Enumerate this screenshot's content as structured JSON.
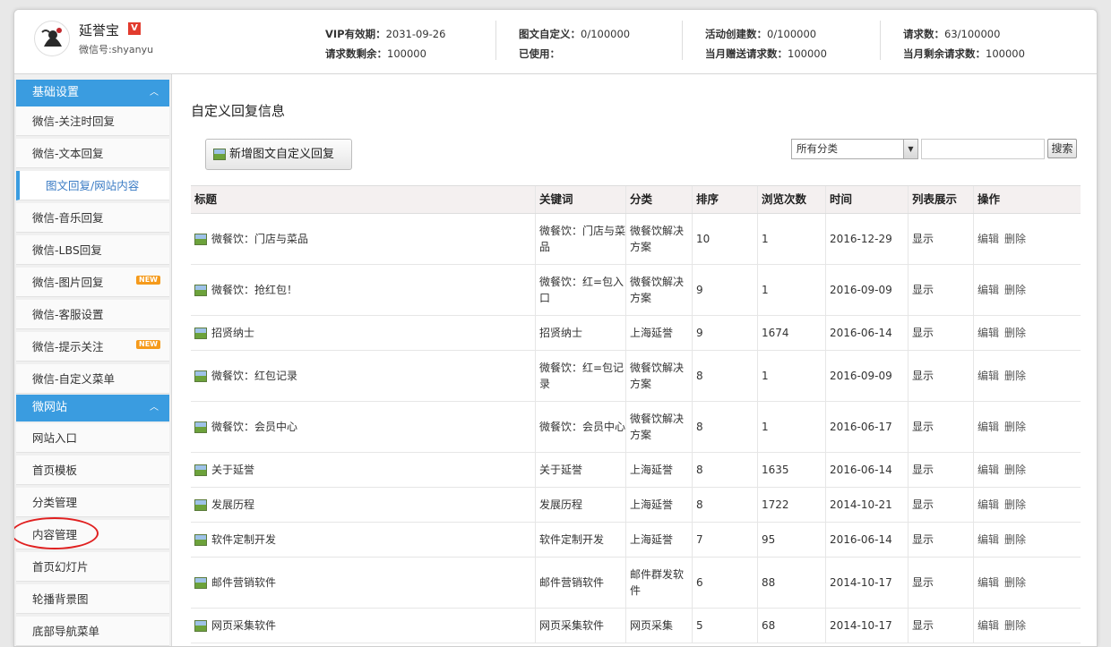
{
  "header": {
    "brand_name": "延誉宝",
    "brand_badge": "V",
    "wechat_id": "微信号:shyanyu",
    "stats": [
      {
        "k1": "VIP有效期：",
        "v1": "2031-09-26",
        "k2": "请求数剩余：",
        "v2": "100000"
      },
      {
        "k1": "图文自定义：",
        "v1": "0/100000",
        "k2": "已使用：",
        "v2": ""
      },
      {
        "k1": "活动创建数：",
        "v1": "0/100000",
        "k2": "当月赠送请求数：",
        "v2": "100000"
      },
      {
        "k1": "请求数：",
        "v1": "63/100000",
        "k2": "当月剩余请求数：",
        "v2": "100000"
      }
    ]
  },
  "sidebar": {
    "sections": [
      {
        "title": "基础设置",
        "chevron": "︿"
      },
      {
        "title": "微网站",
        "chevron": "︿"
      }
    ],
    "items": [
      {
        "label": "微信-关注时回复"
      },
      {
        "label": "微信-文本回复"
      },
      {
        "label": "图文回复/网站内容"
      },
      {
        "label": "微信-音乐回复"
      },
      {
        "label": "微信-LBS回复"
      },
      {
        "label": "微信-图片回复",
        "badge": "NEW"
      },
      {
        "label": "微信-客服设置"
      },
      {
        "label": "微信-提示关注",
        "badge": "NEW"
      },
      {
        "label": "微信-自定义菜单"
      },
      {
        "label": "网站入口"
      },
      {
        "label": "首页模板"
      },
      {
        "label": "分类管理"
      },
      {
        "label": "内容管理"
      },
      {
        "label": "首页幻灯片"
      },
      {
        "label": "轮播背景图"
      },
      {
        "label": "底部导航菜单"
      }
    ]
  },
  "main": {
    "title": "自定义回复信息",
    "add_button": "新增图文自定义回复",
    "category_select": "所有分类",
    "search_value": "",
    "search_button": "搜索",
    "columns": [
      "标题",
      "关键词",
      "分类",
      "排序",
      "浏览次数",
      "时间",
      "列表展示",
      "操作"
    ],
    "op_edit": "编辑",
    "op_delete": "删除",
    "rows": [
      {
        "title": "微餐饮：门店与菜品",
        "keyword": "微餐饮：门店与菜品",
        "category": "微餐饮解决方案",
        "order": "10",
        "views": "1",
        "date": "2016-12-29",
        "display": "显示"
      },
      {
        "title": "微餐饮：抢红包！",
        "keyword": "微餐饮：红=包入口",
        "category": "微餐饮解决方案",
        "order": "9",
        "views": "1",
        "date": "2016-09-09",
        "display": "显示"
      },
      {
        "title": "招贤纳士",
        "keyword": "招贤纳士",
        "category": "上海延誉",
        "order": "9",
        "views": "1674",
        "date": "2016-06-14",
        "display": "显示"
      },
      {
        "title": "微餐饮：红包记录",
        "keyword": "微餐饮：红=包记录",
        "category": "微餐饮解决方案",
        "order": "8",
        "views": "1",
        "date": "2016-09-09",
        "display": "显示"
      },
      {
        "title": "微餐饮：会员中心",
        "keyword": "微餐饮：会员中心",
        "category": "微餐饮解决方案",
        "order": "8",
        "views": "1",
        "date": "2016-06-17",
        "display": "显示"
      },
      {
        "title": "关于延誉",
        "keyword": "关于延誉",
        "category": "上海延誉",
        "order": "8",
        "views": "1635",
        "date": "2016-06-14",
        "display": "显示"
      },
      {
        "title": "发展历程",
        "keyword": "发展历程",
        "category": "上海延誉",
        "order": "8",
        "views": "1722",
        "date": "2014-10-21",
        "display": "显示"
      },
      {
        "title": "软件定制开发",
        "keyword": "软件定制开发",
        "category": "上海延誉",
        "order": "7",
        "views": "95",
        "date": "2016-06-14",
        "display": "显示"
      },
      {
        "title": "邮件营销软件",
        "keyword": "邮件营销软件",
        "category": "邮件群发软件",
        "order": "6",
        "views": "88",
        "date": "2014-10-17",
        "display": "显示"
      },
      {
        "title": "网页采集软件",
        "keyword": "网页采集软件",
        "category": "网页采集",
        "order": "5",
        "views": "68",
        "date": "2014-10-17",
        "display": "显示"
      }
    ]
  },
  "colors": {
    "accent": "#3a9ce0",
    "new_badge": "#f59a1b",
    "highlight_circle": "#e02020"
  }
}
